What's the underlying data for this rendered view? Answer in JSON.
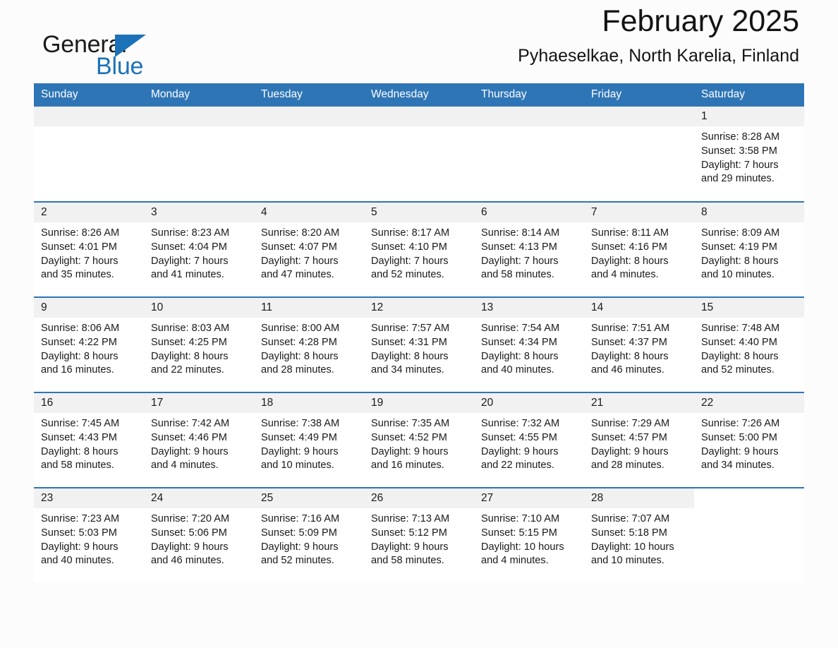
{
  "brand": {
    "name_part1": "General",
    "name_part2": "Blue",
    "accent_color": "#1b72b8",
    "triangle_icon": "triangle-icon"
  },
  "header": {
    "title": "February 2025",
    "subtitle": "Pyhaeselkae, North Karelia, Finland"
  },
  "calendar": {
    "header_bg": "#2e75b6",
    "daynum_bg": "#f1f1f1",
    "weekdays": [
      "Sunday",
      "Monday",
      "Tuesday",
      "Wednesday",
      "Thursday",
      "Friday",
      "Saturday"
    ],
    "weeks": [
      [
        {
          "day": "",
          "sunrise": "",
          "sunset": "",
          "daylight": "",
          "daylight_cont": "",
          "empty": true
        },
        {
          "day": "",
          "sunrise": "",
          "sunset": "",
          "daylight": "",
          "daylight_cont": "",
          "empty": true
        },
        {
          "day": "",
          "sunrise": "",
          "sunset": "",
          "daylight": "",
          "daylight_cont": "",
          "empty": true
        },
        {
          "day": "",
          "sunrise": "",
          "sunset": "",
          "daylight": "",
          "daylight_cont": "",
          "empty": true
        },
        {
          "day": "",
          "sunrise": "",
          "sunset": "",
          "daylight": "",
          "daylight_cont": "",
          "empty": true
        },
        {
          "day": "",
          "sunrise": "",
          "sunset": "",
          "daylight": "",
          "daylight_cont": "",
          "empty": true
        },
        {
          "day": "1",
          "sunrise": "Sunrise: 8:28 AM",
          "sunset": "Sunset: 3:58 PM",
          "daylight": "Daylight: 7 hours",
          "daylight_cont": "and 29 minutes.",
          "empty": false
        }
      ],
      [
        {
          "day": "2",
          "sunrise": "Sunrise: 8:26 AM",
          "sunset": "Sunset: 4:01 PM",
          "daylight": "Daylight: 7 hours",
          "daylight_cont": "and 35 minutes.",
          "empty": false
        },
        {
          "day": "3",
          "sunrise": "Sunrise: 8:23 AM",
          "sunset": "Sunset: 4:04 PM",
          "daylight": "Daylight: 7 hours",
          "daylight_cont": "and 41 minutes.",
          "empty": false
        },
        {
          "day": "4",
          "sunrise": "Sunrise: 8:20 AM",
          "sunset": "Sunset: 4:07 PM",
          "daylight": "Daylight: 7 hours",
          "daylight_cont": "and 47 minutes.",
          "empty": false
        },
        {
          "day": "5",
          "sunrise": "Sunrise: 8:17 AM",
          "sunset": "Sunset: 4:10 PM",
          "daylight": "Daylight: 7 hours",
          "daylight_cont": "and 52 minutes.",
          "empty": false
        },
        {
          "day": "6",
          "sunrise": "Sunrise: 8:14 AM",
          "sunset": "Sunset: 4:13 PM",
          "daylight": "Daylight: 7 hours",
          "daylight_cont": "and 58 minutes.",
          "empty": false
        },
        {
          "day": "7",
          "sunrise": "Sunrise: 8:11 AM",
          "sunset": "Sunset: 4:16 PM",
          "daylight": "Daylight: 8 hours",
          "daylight_cont": "and 4 minutes.",
          "empty": false
        },
        {
          "day": "8",
          "sunrise": "Sunrise: 8:09 AM",
          "sunset": "Sunset: 4:19 PM",
          "daylight": "Daylight: 8 hours",
          "daylight_cont": "and 10 minutes.",
          "empty": false
        }
      ],
      [
        {
          "day": "9",
          "sunrise": "Sunrise: 8:06 AM",
          "sunset": "Sunset: 4:22 PM",
          "daylight": "Daylight: 8 hours",
          "daylight_cont": "and 16 minutes.",
          "empty": false
        },
        {
          "day": "10",
          "sunrise": "Sunrise: 8:03 AM",
          "sunset": "Sunset: 4:25 PM",
          "daylight": "Daylight: 8 hours",
          "daylight_cont": "and 22 minutes.",
          "empty": false
        },
        {
          "day": "11",
          "sunrise": "Sunrise: 8:00 AM",
          "sunset": "Sunset: 4:28 PM",
          "daylight": "Daylight: 8 hours",
          "daylight_cont": "and 28 minutes.",
          "empty": false
        },
        {
          "day": "12",
          "sunrise": "Sunrise: 7:57 AM",
          "sunset": "Sunset: 4:31 PM",
          "daylight": "Daylight: 8 hours",
          "daylight_cont": "and 34 minutes.",
          "empty": false
        },
        {
          "day": "13",
          "sunrise": "Sunrise: 7:54 AM",
          "sunset": "Sunset: 4:34 PM",
          "daylight": "Daylight: 8 hours",
          "daylight_cont": "and 40 minutes.",
          "empty": false
        },
        {
          "day": "14",
          "sunrise": "Sunrise: 7:51 AM",
          "sunset": "Sunset: 4:37 PM",
          "daylight": "Daylight: 8 hours",
          "daylight_cont": "and 46 minutes.",
          "empty": false
        },
        {
          "day": "15",
          "sunrise": "Sunrise: 7:48 AM",
          "sunset": "Sunset: 4:40 PM",
          "daylight": "Daylight: 8 hours",
          "daylight_cont": "and 52 minutes.",
          "empty": false
        }
      ],
      [
        {
          "day": "16",
          "sunrise": "Sunrise: 7:45 AM",
          "sunset": "Sunset: 4:43 PM",
          "daylight": "Daylight: 8 hours",
          "daylight_cont": "and 58 minutes.",
          "empty": false
        },
        {
          "day": "17",
          "sunrise": "Sunrise: 7:42 AM",
          "sunset": "Sunset: 4:46 PM",
          "daylight": "Daylight: 9 hours",
          "daylight_cont": "and 4 minutes.",
          "empty": false
        },
        {
          "day": "18",
          "sunrise": "Sunrise: 7:38 AM",
          "sunset": "Sunset: 4:49 PM",
          "daylight": "Daylight: 9 hours",
          "daylight_cont": "and 10 minutes.",
          "empty": false
        },
        {
          "day": "19",
          "sunrise": "Sunrise: 7:35 AM",
          "sunset": "Sunset: 4:52 PM",
          "daylight": "Daylight: 9 hours",
          "daylight_cont": "and 16 minutes.",
          "empty": false
        },
        {
          "day": "20",
          "sunrise": "Sunrise: 7:32 AM",
          "sunset": "Sunset: 4:55 PM",
          "daylight": "Daylight: 9 hours",
          "daylight_cont": "and 22 minutes.",
          "empty": false
        },
        {
          "day": "21",
          "sunrise": "Sunrise: 7:29 AM",
          "sunset": "Sunset: 4:57 PM",
          "daylight": "Daylight: 9 hours",
          "daylight_cont": "and 28 minutes.",
          "empty": false
        },
        {
          "day": "22",
          "sunrise": "Sunrise: 7:26 AM",
          "sunset": "Sunset: 5:00 PM",
          "daylight": "Daylight: 9 hours",
          "daylight_cont": "and 34 minutes.",
          "empty": false
        }
      ],
      [
        {
          "day": "23",
          "sunrise": "Sunrise: 7:23 AM",
          "sunset": "Sunset: 5:03 PM",
          "daylight": "Daylight: 9 hours",
          "daylight_cont": "and 40 minutes.",
          "empty": false
        },
        {
          "day": "24",
          "sunrise": "Sunrise: 7:20 AM",
          "sunset": "Sunset: 5:06 PM",
          "daylight": "Daylight: 9 hours",
          "daylight_cont": "and 46 minutes.",
          "empty": false
        },
        {
          "day": "25",
          "sunrise": "Sunrise: 7:16 AM",
          "sunset": "Sunset: 5:09 PM",
          "daylight": "Daylight: 9 hours",
          "daylight_cont": "and 52 minutes.",
          "empty": false
        },
        {
          "day": "26",
          "sunrise": "Sunrise: 7:13 AM",
          "sunset": "Sunset: 5:12 PM",
          "daylight": "Daylight: 9 hours",
          "daylight_cont": "and 58 minutes.",
          "empty": false
        },
        {
          "day": "27",
          "sunrise": "Sunrise: 7:10 AM",
          "sunset": "Sunset: 5:15 PM",
          "daylight": "Daylight: 10 hours",
          "daylight_cont": "and 4 minutes.",
          "empty": false
        },
        {
          "day": "28",
          "sunrise": "Sunrise: 7:07 AM",
          "sunset": "Sunset: 5:18 PM",
          "daylight": "Daylight: 10 hours",
          "daylight_cont": "and 10 minutes.",
          "empty": false
        },
        {
          "day": "",
          "sunrise": "",
          "sunset": "",
          "daylight": "",
          "daylight_cont": "",
          "empty": true
        }
      ]
    ]
  }
}
